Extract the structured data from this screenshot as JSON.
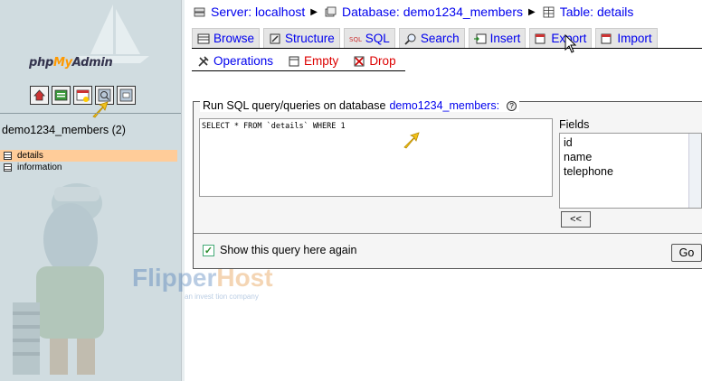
{
  "app": {
    "logo_part1": "php",
    "logo_part2": "My",
    "logo_part3": "Admin"
  },
  "left": {
    "icons": [
      "home-icon",
      "sql-query-icon",
      "sql-window-icon",
      "help-icon",
      "docs-icon"
    ],
    "database": "demo1234_members (2)",
    "tables": [
      {
        "name": "details",
        "active": true
      },
      {
        "name": "information",
        "active": false
      }
    ]
  },
  "breadcrumb": {
    "server_label": "Server: localhost",
    "database_label": "Database: demo1234_members",
    "table_label": "Table: details",
    "separator": "▶"
  },
  "tabs_row1": [
    {
      "label": "Browse",
      "icon": "browse-icon"
    },
    {
      "label": "Structure",
      "icon": "structure-icon"
    },
    {
      "label": "SQL",
      "icon": "sql-icon"
    },
    {
      "label": "Search",
      "icon": "search-icon"
    },
    {
      "label": "Insert",
      "icon": "insert-icon"
    },
    {
      "label": "Export",
      "icon": "export-icon"
    },
    {
      "label": "Import",
      "icon": "import-icon"
    }
  ],
  "tabs_row2": [
    {
      "label": "Operations",
      "icon": "operations-icon"
    },
    {
      "label": "Empty",
      "icon": "empty-icon"
    },
    {
      "label": "Drop",
      "icon": "drop-icon"
    }
  ],
  "sql": {
    "legend_prefix": "Run SQL query/queries on database",
    "legend_db": "demo1234_members:",
    "help_glyph": "?",
    "query": "SELECT * FROM `details` WHERE 1",
    "fields_label": "Fields",
    "fields": [
      "id",
      "name",
      "telephone"
    ],
    "insert_button": "<<",
    "show_again_label": "Show this query here again",
    "show_again_checked": true,
    "go_button": "Go"
  },
  "watermark": {
    "brand_main": "Flipper",
    "brand_accent": "Host",
    "tagline": "an invest tion company"
  },
  "colors": {
    "link": "#0000ee",
    "danger": "#dd0000",
    "nav_bg": "#d0dce0",
    "active_table": "#ffcc99"
  }
}
